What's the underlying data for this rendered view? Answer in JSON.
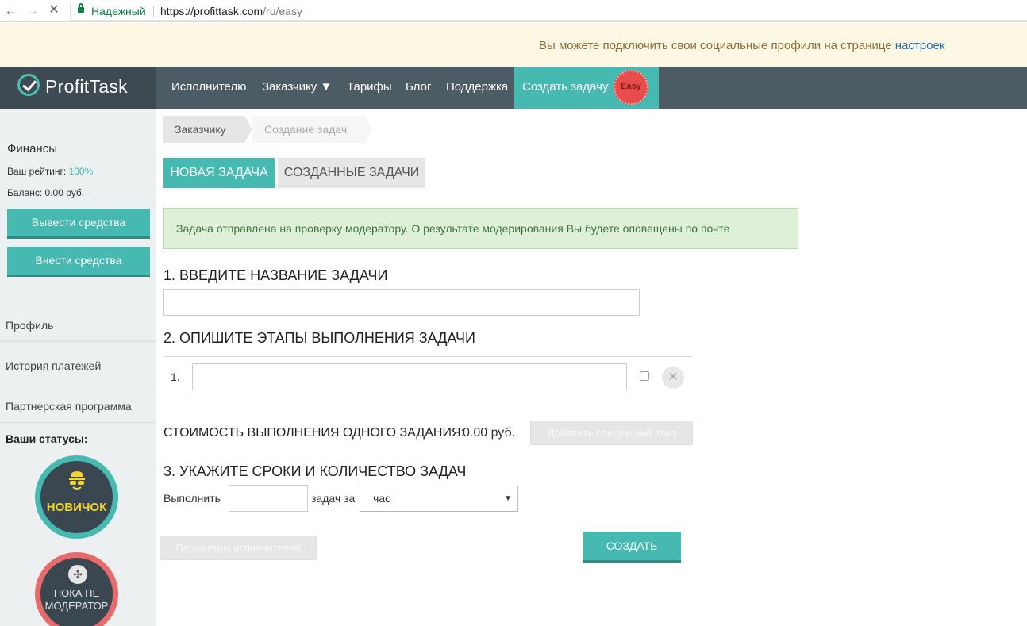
{
  "browser": {
    "secure_label": "Надежный",
    "url_host": "https://profittask.com",
    "url_path": "/ru/easy"
  },
  "notice": {
    "text": "Вы можете подключить свои социальные профили на странице ",
    "link": "настроек"
  },
  "header": {
    "logo": "ProfitTask",
    "menu": [
      "Исполнителю",
      "Заказчику ▼",
      "Тарифы",
      "Блог",
      "Поддержка"
    ],
    "active": "Создать задачу",
    "badge": "Easy"
  },
  "sidebar": {
    "title": "Финансы",
    "rating_label": "Ваш рейтинг: ",
    "rating_value": "100%",
    "balance_label": "Баланс: ",
    "balance_value": "0.00 руб.",
    "withdraw": "Вывести средства",
    "deposit": "Внести средства",
    "links": [
      "Профиль",
      "История платежей",
      "Партнерская программа"
    ],
    "statuses_title": "Ваши статусы:",
    "status_novice": "НОВИЧОК",
    "status_mod_line1": "ПОКА НЕ",
    "status_mod_line2": "МОДЕРАТОР"
  },
  "breadcrumb": [
    "Заказчику",
    "Создание задач"
  ],
  "tabs": [
    "НОВАЯ ЗАДАЧА",
    "СОЗДАННЫЕ ЗАДАЧИ"
  ],
  "alert": "Задача отправлена на проверку модератору. О результате модерирования Вы будете оповещены по почте",
  "form": {
    "section1": "1. ВВЕДИТЕ НАЗВАНИЕ ЗАДАЧИ",
    "title_value": "",
    "section2": "2. ОПИШИТЕ ЭТАПЫ ВЫПОЛНЕНИЯ ЗАДАЧИ",
    "step_number": "1.",
    "step_value": "",
    "cost_label": "СТОИМОСТЬ ВЫПОЛНЕНИЯ ОДНОГО ЗАДАНИЯ:",
    "cost_value": "0.00 руб.",
    "add_step": "Добавить следующий этап",
    "section3": "3. УКАЖИТЕ СРОКИ И КОЛИЧЕСТВО ЗАДАЧ",
    "execute_label": "Выполнить",
    "tasks_per": "задач за",
    "count_value": "",
    "period_selected": "час",
    "params_button": "Параметры исполнителей",
    "create_button": "СОЗДАТЬ"
  }
}
